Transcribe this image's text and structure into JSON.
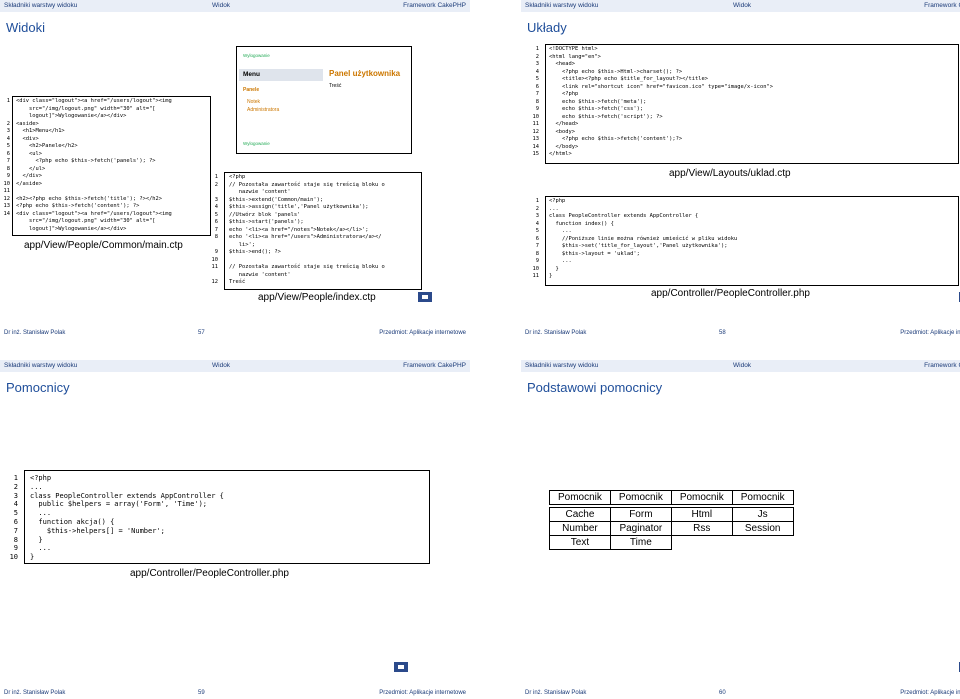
{
  "header": {
    "left": "Składniki warstwy widoku",
    "mid": "Widok",
    "right": "Framework CakePHP"
  },
  "footer": {
    "author": "Dr inż. Stanisław Polak",
    "subject": "Przedmiot: Aplikacje internetowe"
  },
  "slides": {
    "s57": {
      "title": "Widoki",
      "page": "57",
      "code1": [
        "<div class=\"logout\"><a href=\"/users/logout\"><img",
        "    src=\"/img/logout.png\" width=\"30\" alt=\"[",
        "    logout]\">Wylogowanie</a></div>",
        "<aside>",
        "  <h1>Menu</h1>",
        "  <div>",
        "    <h2>Panele</h2>",
        "    <ul>",
        "      <?php echo $this->fetch('panels'); ?>",
        "    </ul>",
        "  </div>",
        "</aside>",
        "",
        "<h2><?php echo $this->fetch('title'); ?></h2>",
        "<?php echo $this->fetch('content'); ?>",
        "<div class=\"logout\"><a href=\"/users/logout\"><img",
        "    src=\"/img/logout.png\" width=\"30\" alt=\"[",
        "    logout]\">Wylogowanie</a></div>"
      ],
      "nums1": [
        "1",
        "",
        "",
        "2",
        "3",
        "4",
        "5",
        "6",
        "7",
        "8",
        "9",
        "10",
        "11",
        "12",
        "13",
        "14",
        "",
        ""
      ],
      "caption1": "app/View/People/Common/main.ctp",
      "mock": {
        "logo1": "Wylogowanie",
        "menu": "Menu",
        "panels": "Panele",
        "item1": "Notek",
        "item2": "Administratora",
        "logo2": "Wylogowanie",
        "panel_title": "Panel użytkownika",
        "content": "Treść"
      },
      "code2": [
        "<?php",
        "// Pozostała zawartość staje się treścią bloku o",
        "   nazwie 'content'",
        "$this->extend('Common/main');",
        "$this->assign('title','Panel użytkownika');",
        "//Utwórz blok 'panels'",
        "$this->start('panels');",
        "echo '<li><a href=\"/notes\">Notek</a></li>';",
        "echo '<li><a href=\"/users\">Administratora</a></",
        "   li>';",
        "$this->end(); ?>",
        "",
        "// Pozostała zawartość staje się treścią bloku o",
        "   nazwie 'content'",
        "Treść"
      ],
      "nums2": [
        "1",
        "2",
        "",
        "3",
        "4",
        "5",
        "6",
        "7",
        "8",
        "",
        "9",
        "10",
        "11",
        "",
        "12"
      ],
      "caption2": "app/View/People/index.ctp"
    },
    "s58": {
      "title": "Układy",
      "page": "58",
      "code1": [
        "<!DOCTYPE html>",
        "<html lang=\"en\">",
        "  <head>",
        "    <?php echo $this->Html->charset(); ?>",
        "    <title><?php echo $title_for_layout?></title>",
        "    <link rel=\"shortcut icon\" href=\"favicon.ico\" type=\"image/x-icon\">",
        "    <?php",
        "    echo $this->fetch('meta');",
        "    echo $this->fetch('css');",
        "    echo $this->fetch('script'); ?>",
        "  </head>",
        "  <body>",
        "    <?php echo $this->fetch('content');?>",
        "  </body>",
        "</html>"
      ],
      "nums1": [
        "1",
        "2",
        "3",
        "4",
        "5",
        "6",
        "7",
        "8",
        "9",
        "10",
        "11",
        "12",
        "13",
        "14",
        "15"
      ],
      "caption1": "app/View/Layouts/uklad.ctp",
      "code2": [
        "<?php",
        "...",
        "class PeopleController extends AppController {",
        "  function index() {",
        "    ...",
        "    //Poniższe linie można również umieścić w pliku widoku",
        "    $this->set('title_for_layout','Panel użytkownika');",
        "    $this->layout = 'uklad';",
        "    ...",
        "  }",
        "}"
      ],
      "nums2": [
        "1",
        "2",
        "3",
        "4",
        "5",
        "6",
        "7",
        "8",
        "9",
        "10",
        "11"
      ],
      "caption2": "app/Controller/PeopleController.php"
    },
    "s59": {
      "title": "Pomocnicy",
      "page": "59",
      "code1": [
        "<?php",
        "...",
        "class PeopleController extends AppController {",
        "  public $helpers = array('Form', 'Time');",
        "  ...",
        "  function akcja() {",
        "    $this->helpers[] = 'Number';",
        "  }",
        "  ...",
        "}"
      ],
      "nums1": [
        "1",
        "2",
        "3",
        "4",
        "5",
        "6",
        "7",
        "8",
        "9",
        "10"
      ],
      "caption1": "app/Controller/PeopleController.php"
    },
    "s60": {
      "title": "Podstawowi pomocnicy",
      "page": "60",
      "table_header": [
        "Pomocnik",
        "Pomocnik",
        "Pomocnik",
        "Pomocnik"
      ],
      "table_rows": [
        [
          "Cache",
          "Form",
          "Html",
          "Js"
        ],
        [
          "Number",
          "Paginator",
          "Rss",
          "Session"
        ],
        [
          "Text",
          "Time",
          "",
          ""
        ]
      ]
    }
  }
}
